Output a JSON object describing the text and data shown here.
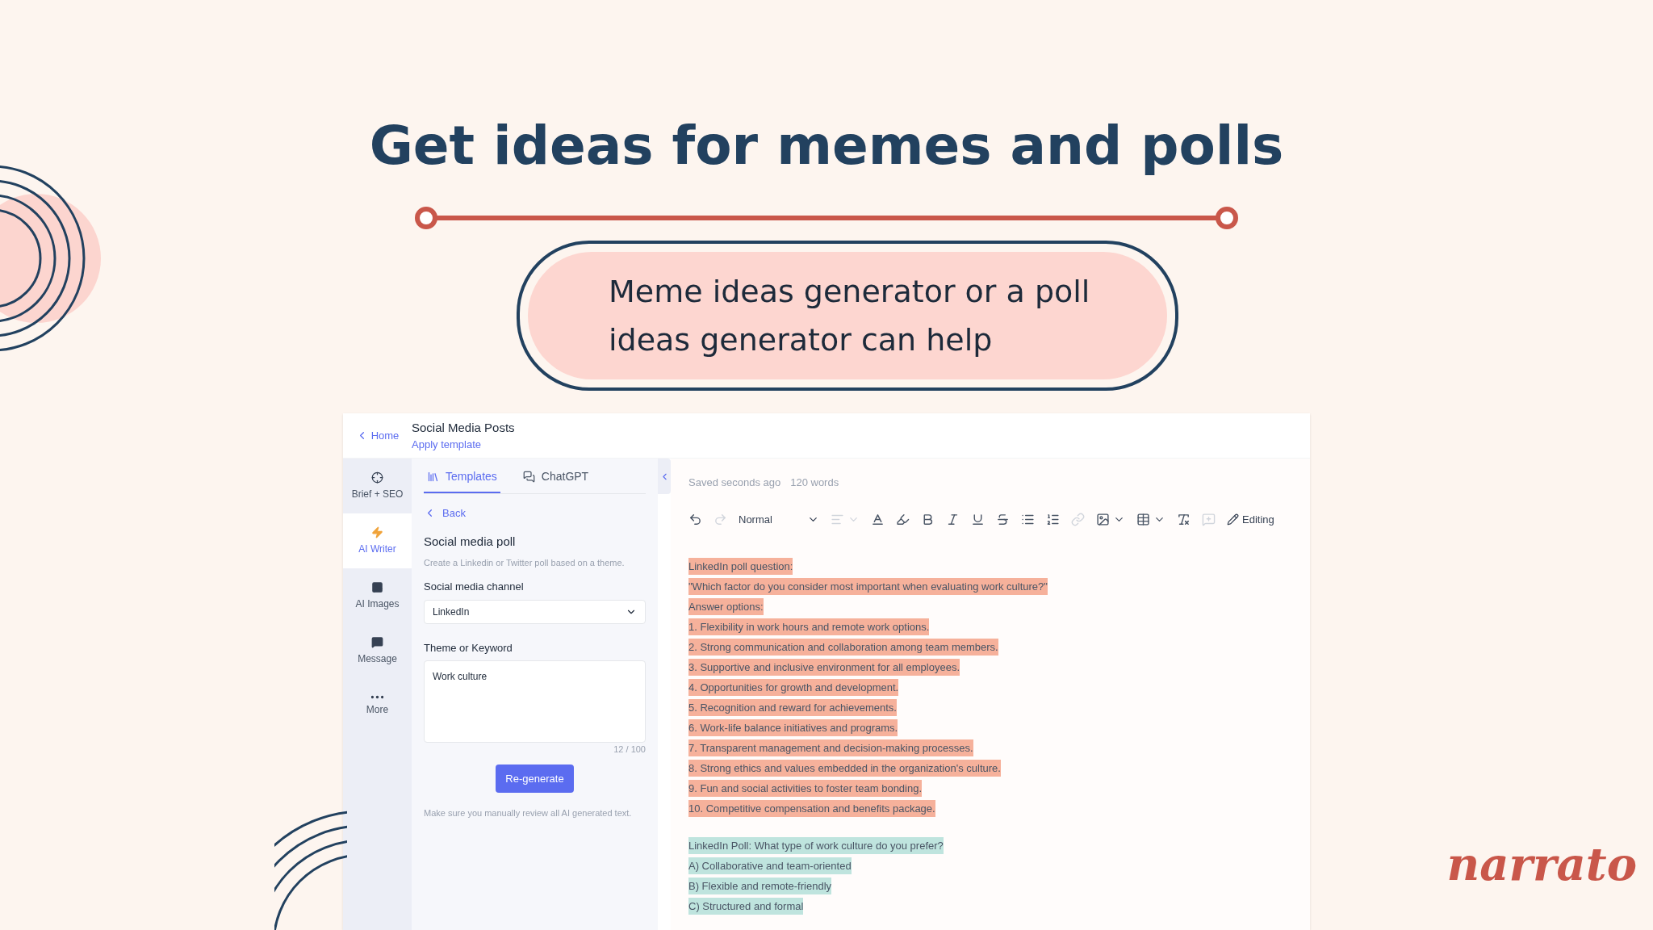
{
  "headline": "Get ideas for memes and polls",
  "subtitle": "Meme ideas generator or a poll ideas generator can help",
  "app": {
    "header": {
      "back": "Home",
      "title": "Social Media Posts",
      "link": "Apply template"
    },
    "nav": [
      {
        "label": "Brief + SEO",
        "selected": false
      },
      {
        "label": "AI Writer",
        "selected": true
      },
      {
        "label": "AI Images",
        "selected": false
      },
      {
        "label": "Message",
        "selected": false
      },
      {
        "label": "More",
        "selected": false
      }
    ],
    "tabs": [
      {
        "label": "Templates",
        "selected": true
      },
      {
        "label": "ChatGPT",
        "selected": false
      }
    ],
    "panel": {
      "back": "Back",
      "template_title": "Social media poll",
      "template_description": "Create a Linkedin or Twitter poll based on a theme.",
      "channel": {
        "label": "Social media channel",
        "value": "LinkedIn"
      },
      "theme": {
        "label": "Theme or Keyword",
        "value": "Work culture",
        "count": "12 / 100"
      },
      "button": "Re-generate",
      "note": "Make sure you manually review all AI generated text."
    },
    "editor": {
      "status": "Saved seconds ago",
      "words": "120 words",
      "style": "Normal",
      "mode": "Editing",
      "blocks": [
        {
          "color": "#f6b19b",
          "lines": [
            "LinkedIn poll question:",
            "\"Which factor do you consider most important when evaluating work culture?\"",
            "Answer options:",
            "1. Flexibility in work hours and remote work options.",
            "2. Strong communication and collaboration among team members.",
            "3. Supportive and inclusive environment for all employees.",
            "4. Opportunities for growth and development.",
            "5. Recognition and reward for achievements.",
            "6. Work-life balance initiatives and programs.",
            "7. Transparent management and decision-making processes.",
            "8. Strong ethics and values embedded in the organization's culture.",
            "9. Fun and social activities to foster team bonding.",
            "10. Competitive compensation and benefits package."
          ]
        },
        {
          "color": "#bfe4de",
          "lines": [
            "LinkedIn Poll: What type of work culture do you prefer?",
            "A) Collaborative and team-oriented",
            "B) Flexible and remote-friendly",
            "C) Structured and formal"
          ]
        }
      ]
    }
  },
  "logo": "narrato"
}
